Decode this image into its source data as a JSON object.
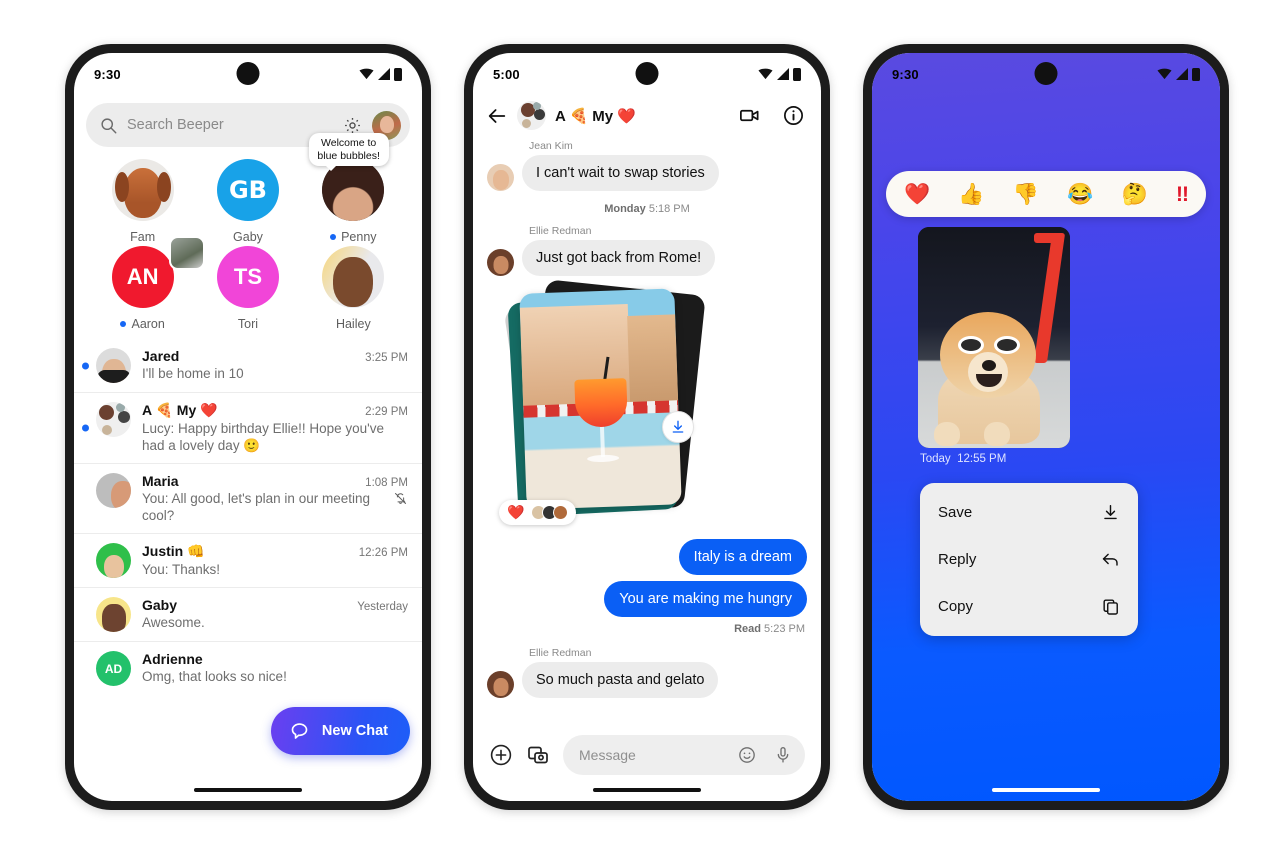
{
  "phone1": {
    "status": {
      "time": "9:30",
      "icons": [
        "wifi-icon",
        "signal-icon",
        "battery-icon"
      ]
    },
    "search": {
      "placeholder": "Search Beeper",
      "icon": "search-icon",
      "settings_icon": "gear-icon",
      "avatar": "profile-avatar"
    },
    "stories": [
      {
        "name": "Fam",
        "unread": false,
        "tooltip": null,
        "kind": "photo"
      },
      {
        "name": "Gaby",
        "unread": false,
        "tooltip": null,
        "kind": "logo",
        "initials": "GB"
      },
      {
        "name": "Penny",
        "unread": true,
        "tooltip": "Welcome to blue bubbles!",
        "kind": "photo"
      },
      {
        "name": "Aaron",
        "unread": true,
        "tooltip": null,
        "kind": "logo",
        "initials": "AN",
        "badge": true
      },
      {
        "name": "Tori",
        "unread": false,
        "tooltip": null,
        "kind": "logo",
        "initials": "TS"
      },
      {
        "name": "Hailey",
        "unread": false,
        "tooltip": null,
        "kind": "photo"
      }
    ],
    "chats": [
      {
        "name": "Jared",
        "time": "3:25 PM",
        "preview": "I'll be home in 10",
        "unread": true,
        "muted": false
      },
      {
        "name": "A 🍕 My ❤️",
        "time": "2:29 PM",
        "preview": "Lucy: Happy birthday Ellie!! Hope you've had a lovely day  🙂",
        "unread": true,
        "muted": false
      },
      {
        "name": "Maria",
        "time": "1:08 PM",
        "preview": "You: All good, let's plan in our meeting cool?",
        "unread": false,
        "muted": true
      },
      {
        "name": "Justin 👊",
        "time": "12:26 PM",
        "preview": "You: Thanks!",
        "unread": false,
        "muted": false
      },
      {
        "name": "Gaby",
        "time": "Yesterday",
        "preview": "Awesome.",
        "unread": false,
        "muted": false
      },
      {
        "name": "Adrienne",
        "time": "",
        "preview": "Omg, that looks so nice!",
        "unread": false,
        "muted": false,
        "initials": "AD"
      }
    ],
    "fab": {
      "label": "New Chat",
      "icon": "chat-bubble-icon"
    }
  },
  "phone2": {
    "status": {
      "time": "5:00"
    },
    "header": {
      "back_icon": "back-arrow-icon",
      "title": "A 🍕 My ❤️",
      "video_icon": "video-camera-icon",
      "info_icon": "info-icon"
    },
    "messages": [
      {
        "type": "incoming",
        "sender": "Jean Kim",
        "text": "I can't wait to swap stories"
      },
      {
        "type": "daystamp",
        "day": "Monday",
        "time": "5:18 PM"
      },
      {
        "type": "incoming",
        "sender": "Ellie Redman",
        "text": "Just got back from Rome!"
      },
      {
        "type": "photo-stack",
        "reaction": "❤️",
        "reactors": 3,
        "download_icon": "download-icon"
      },
      {
        "type": "outgoing",
        "text": "Italy is a dream"
      },
      {
        "type": "outgoing",
        "text": "You are making me hungry"
      },
      {
        "type": "receipt",
        "status": "Read",
        "time": "5:23 PM"
      },
      {
        "type": "incoming",
        "sender": "Ellie Redman",
        "text": "So much pasta and gelato"
      }
    ],
    "composer": {
      "plus_icon": "plus-circle-icon",
      "media_icon": "photo-gallery-icon",
      "placeholder": "Message",
      "emoji_icon": "emoji-smiley-icon",
      "mic_icon": "microphone-icon"
    }
  },
  "phone3": {
    "status": {
      "time": "9:30"
    },
    "reactions": [
      "❤️",
      "👍",
      "👎",
      "😂",
      "🤔",
      "!!"
    ],
    "photo": {
      "alt": "dog-with-sunglasses-photo"
    },
    "timestamp": {
      "day": "Today",
      "time": "12:55 PM"
    },
    "menu": [
      {
        "label": "Save",
        "icon": "download-icon"
      },
      {
        "label": "Reply",
        "icon": "reply-arrow-icon"
      },
      {
        "label": "Copy",
        "icon": "copy-icon"
      }
    ],
    "colors": {
      "gradient_top": "#5a4ae0",
      "gradient_bottom": "#0057ff"
    }
  },
  "theme": {
    "accent_blue": "#0a5ff5",
    "unread_dot": "#1667f5",
    "bubble_in": "#ececec",
    "fab_gradient": [
      "#6b3ff0",
      "#1d5ef8"
    ]
  }
}
